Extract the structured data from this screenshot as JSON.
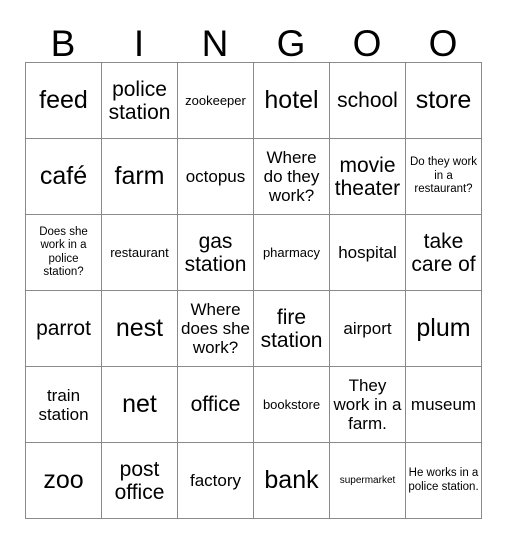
{
  "card": {
    "header_letters": [
      "B",
      "I",
      "N",
      "G",
      "O",
      "O"
    ],
    "columns": 6,
    "rows": 6,
    "border_color": "#8a8a8a",
    "text_color": "#000000",
    "background": "#ffffff",
    "cells": [
      [
        {
          "text": "feed",
          "size": "xl"
        },
        {
          "text": "police station",
          "size": "lg"
        },
        {
          "text": "zookeeper",
          "size": "sm"
        },
        {
          "text": "hotel",
          "size": "xl"
        },
        {
          "text": "school",
          "size": "lg"
        },
        {
          "text": "store",
          "size": "xl"
        }
      ],
      [
        {
          "text": "café",
          "size": "xl"
        },
        {
          "text": "farm",
          "size": "xl"
        },
        {
          "text": "octopus",
          "size": "md"
        },
        {
          "text": "Where do they work?",
          "size": "md"
        },
        {
          "text": "movie theater",
          "size": "lg"
        },
        {
          "text": "Do they work in a restaurant?",
          "size": "xs"
        }
      ],
      [
        {
          "text": "Does she work in a police station?",
          "size": "xs"
        },
        {
          "text": "restaurant",
          "size": "sm"
        },
        {
          "text": "gas station",
          "size": "lg"
        },
        {
          "text": "pharmacy",
          "size": "sm"
        },
        {
          "text": "hospital",
          "size": "md"
        },
        {
          "text": "take care of",
          "size": "lg"
        }
      ],
      [
        {
          "text": "parrot",
          "size": "lg"
        },
        {
          "text": "nest",
          "size": "xl"
        },
        {
          "text": "Where does she work?",
          "size": "md"
        },
        {
          "text": "fire station",
          "size": "lg"
        },
        {
          "text": "airport",
          "size": "md"
        },
        {
          "text": "plum",
          "size": "xl"
        }
      ],
      [
        {
          "text": "train station",
          "size": "md"
        },
        {
          "text": "net",
          "size": "xl"
        },
        {
          "text": "office",
          "size": "lg"
        },
        {
          "text": "bookstore",
          "size": "sm"
        },
        {
          "text": "They work in a farm.",
          "size": "md"
        },
        {
          "text": "museum",
          "size": "md"
        }
      ],
      [
        {
          "text": "zoo",
          "size": "xl"
        },
        {
          "text": "post office",
          "size": "lg"
        },
        {
          "text": "factory",
          "size": "md"
        },
        {
          "text": "bank",
          "size": "xl"
        },
        {
          "text": "supermarket",
          "size": "xxs"
        },
        {
          "text": "He works in a police station.",
          "size": "xs"
        }
      ]
    ]
  }
}
